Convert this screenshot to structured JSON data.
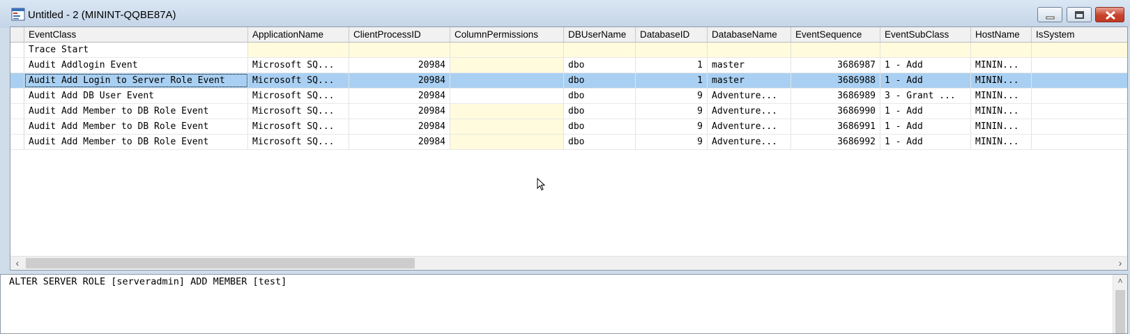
{
  "window": {
    "title": "Untitled - 2 (MININT-QQBE87A)",
    "buttons": {
      "minimize": "minimize-icon",
      "maximize": "maximize-icon",
      "close": "close-icon"
    }
  },
  "grid": {
    "columns": [
      "EventClass",
      "ApplicationName",
      "ClientProcessID",
      "ColumnPermissions",
      "DBUserName",
      "DatabaseID",
      "DatabaseName",
      "EventSequence",
      "EventSubClass",
      "HostName",
      "IsSystem"
    ],
    "rows": [
      [
        "Trace Start",
        "",
        "",
        "",
        "",
        "",
        "",
        "",
        "",
        "",
        ""
      ],
      [
        "Audit Addlogin Event",
        "Microsoft SQ...",
        "20984",
        "",
        "dbo",
        "1",
        "master",
        "3686987",
        "1 - Add",
        "MININ...",
        ""
      ],
      [
        "Audit Add Login to Server Role Event",
        "Microsoft SQ...",
        "20984",
        "",
        "dbo",
        "1",
        "master",
        "3686988",
        "1 - Add",
        "MININ...",
        ""
      ],
      [
        "Audit Add DB User Event",
        "Microsoft SQ...",
        "20984",
        "",
        "dbo",
        "9",
        "Adventure...",
        "3686989",
        "3 - Grant ...",
        "MININ...",
        ""
      ],
      [
        "Audit Add Member to DB Role Event",
        "Microsoft SQ...",
        "20984",
        "",
        "dbo",
        "9",
        "Adventure...",
        "3686990",
        "1 - Add",
        "MININ...",
        ""
      ],
      [
        "Audit Add Member to DB Role Event",
        "Microsoft SQ...",
        "20984",
        "",
        "dbo",
        "9",
        "Adventure...",
        "3686991",
        "1 - Add",
        "MININ...",
        ""
      ],
      [
        "Audit Add Member to DB Role Event",
        "Microsoft SQ...",
        "20984",
        "",
        "dbo",
        "9",
        "Adventure...",
        "3686992",
        "1 - Add",
        "MININ...",
        ""
      ]
    ],
    "selected_row": 2
  },
  "text_pane": {
    "content": "ALTER SERVER ROLE [serveradmin] ADD MEMBER [test]"
  },
  "colors": {
    "selection": "#a9d0f2",
    "unavailable_cell": "#fffbdc"
  }
}
